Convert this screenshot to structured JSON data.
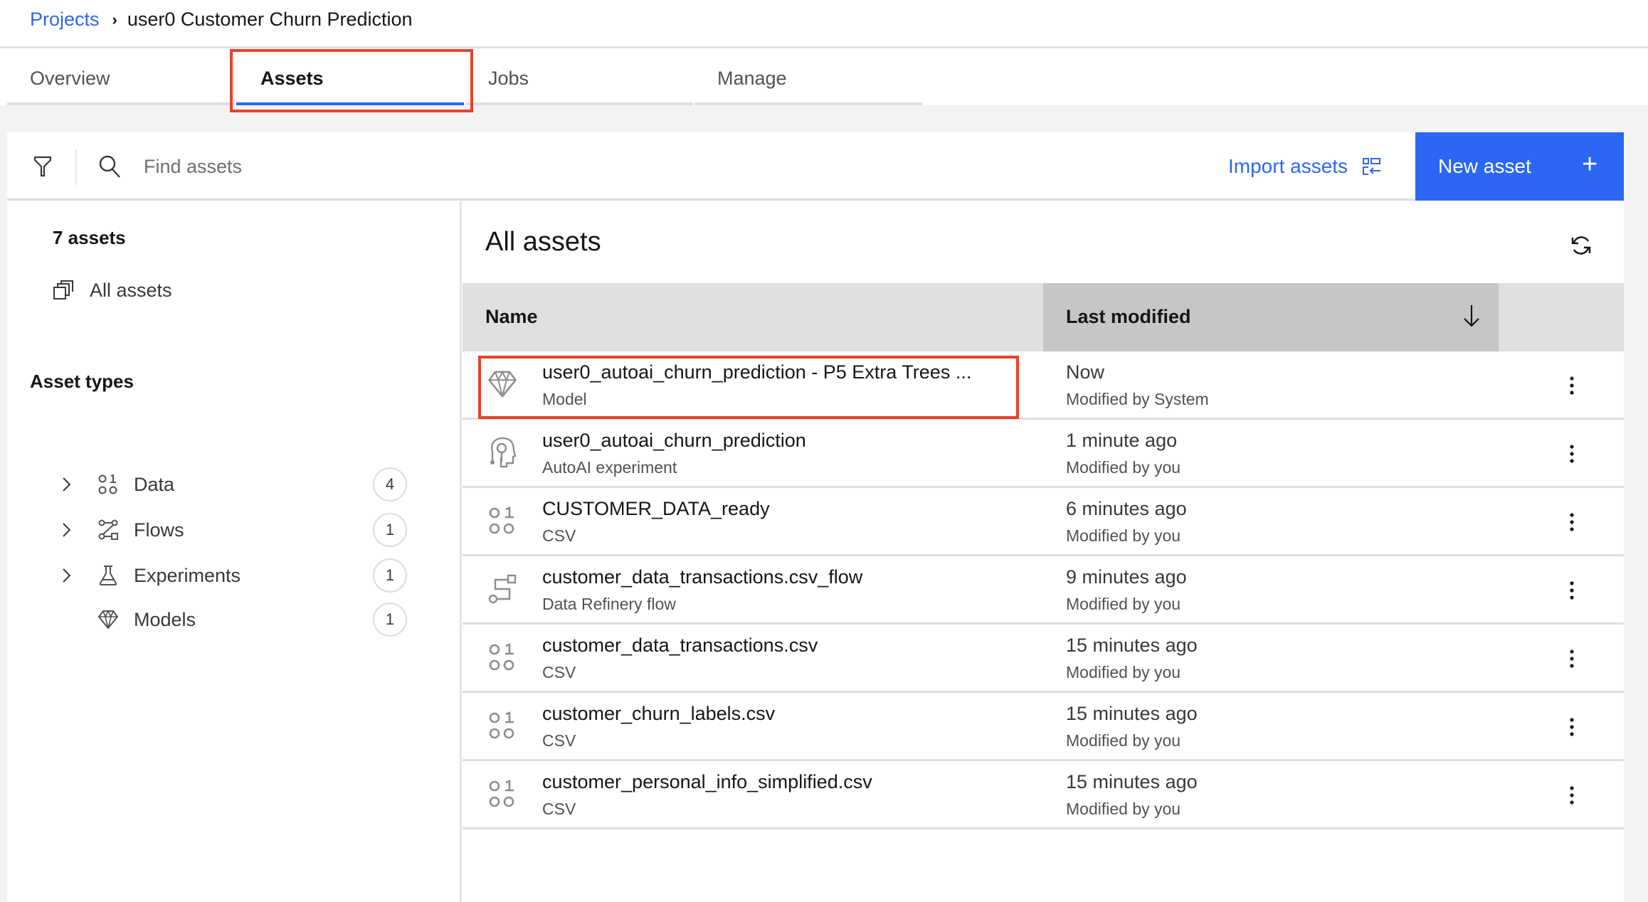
{
  "breadcrumb": {
    "parent": "Projects",
    "current": "user0 Customer Churn Prediction"
  },
  "tabs": [
    {
      "label": "Overview",
      "active": false
    },
    {
      "label": "Assets",
      "active": true
    },
    {
      "label": "Jobs",
      "active": false
    },
    {
      "label": "Manage",
      "active": false
    }
  ],
  "toolbar": {
    "search_placeholder": "Find assets",
    "search_value": "",
    "import_label": "Import assets",
    "new_label": "New asset",
    "new_icon": "+"
  },
  "sidebar": {
    "count_title": "7 assets",
    "all_assets_label": "All assets",
    "types_title": "Asset types",
    "types": [
      {
        "label": "Data",
        "count": "4",
        "icon": "data-icon",
        "expandable": true
      },
      {
        "label": "Flows",
        "count": "1",
        "icon": "flows-icon",
        "expandable": true
      },
      {
        "label": "Experiments",
        "count": "1",
        "icon": "flask-icon",
        "expandable": true
      },
      {
        "label": "Models",
        "count": "1",
        "icon": "diamond-icon",
        "expandable": false
      }
    ]
  },
  "main": {
    "title": "All assets",
    "columns": {
      "name": "Name",
      "modified": "Last modified",
      "sort": "descending"
    },
    "rows": [
      {
        "name": "user0_autoai_churn_prediction - P5 Extra Trees ...",
        "type": "Model",
        "time": "Now",
        "by": "Modified by System",
        "icon": "model-diamond-icon"
      },
      {
        "name": "user0_autoai_churn_prediction",
        "type": "AutoAI experiment",
        "time": "1 minute ago",
        "by": "Modified by you",
        "icon": "autoai-experiment-icon"
      },
      {
        "name": "CUSTOMER_DATA_ready",
        "type": "CSV",
        "time": "6 minutes ago",
        "by": "Modified by you",
        "icon": "data-csv-icon"
      },
      {
        "name": "customer_data_transactions.csv_flow",
        "type": "Data Refinery flow",
        "time": "9 minutes ago",
        "by": "Modified by you",
        "icon": "refinery-flow-icon"
      },
      {
        "name": "customer_data_transactions.csv",
        "type": "CSV",
        "time": "15 minutes ago",
        "by": "Modified by you",
        "icon": "data-csv-icon"
      },
      {
        "name": "customer_churn_labels.csv",
        "type": "CSV",
        "time": "15 minutes ago",
        "by": "Modified by you",
        "icon": "data-csv-icon"
      },
      {
        "name": "customer_personal_info_simplified.csv",
        "type": "CSV",
        "time": "15 minutes ago",
        "by": "Modified by you",
        "icon": "data-csv-icon"
      }
    ]
  },
  "colors": {
    "accent": "#2d66f0",
    "primary_button": "#2b67f3",
    "highlight_box": "#e8412c",
    "header_bg": "#e0e0e0",
    "sorted_header_bg": "#c6c6c6",
    "page_bg": "#f3f3f3"
  }
}
